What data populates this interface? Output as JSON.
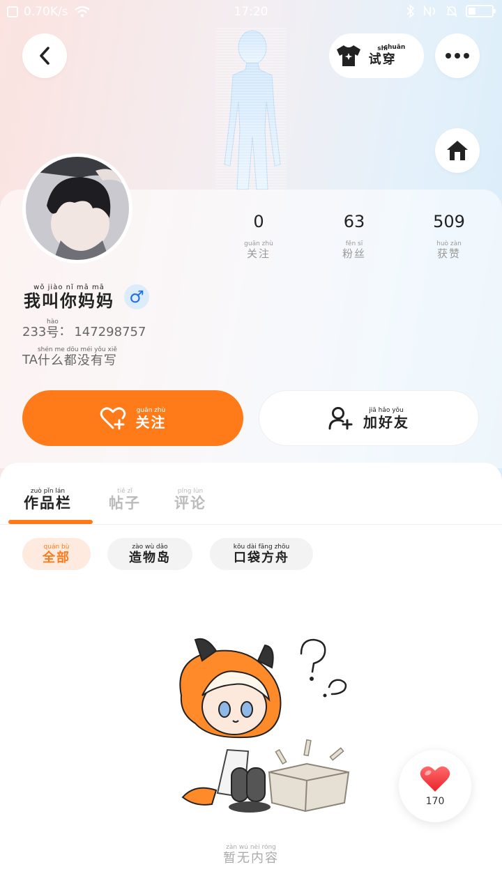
{
  "status_bar": {
    "speed": "0.70K/s",
    "time": "17:20"
  },
  "header": {
    "tryon": {
      "pinyin": [
        "shì",
        "chuān"
      ],
      "label": "试穿"
    }
  },
  "profile": {
    "stats": [
      {
        "value": "0",
        "pinyin": "guān zhù",
        "label": "关注"
      },
      {
        "value": "63",
        "pinyin": "fěn sī",
        "label": "粉丝"
      },
      {
        "value": "509",
        "pinyin": "huò zàn",
        "label": "获赞"
      }
    ],
    "nickname": {
      "pinyin": "wǒ jiào nǐ mā mā",
      "text": "我叫你妈妈"
    },
    "gender_symbol": "♂",
    "id": {
      "prefix": "233",
      "hao_pinyin": "hào",
      "hao": "号",
      "colon": "：",
      "value": "147298757"
    },
    "bio": {
      "prefix": "TA",
      "pinyin": "shén me dōu méi yǒu xiě",
      "text": "什么都没有写"
    }
  },
  "actions": {
    "follow": {
      "pinyin": "guān zhù",
      "label": "关注"
    },
    "add_friend": {
      "pinyin": "jiā hǎo yǒu",
      "label": "加好友"
    }
  },
  "tabs": [
    {
      "pinyin": "zuò pǐn lán",
      "label": "作品栏",
      "active": true
    },
    {
      "pinyin": "tiě zǐ",
      "label": "帖子",
      "active": false
    },
    {
      "pinyin": "píng lùn",
      "label": "评论",
      "active": false
    }
  ],
  "filters": [
    {
      "pinyin": "quán bù",
      "label": "全部",
      "active": true
    },
    {
      "pinyin": "zào wù dǎo",
      "label": "造物岛",
      "active": false
    },
    {
      "pinyin": "kǒu dài fāng zhōu",
      "label": "口袋方舟",
      "active": false
    }
  ],
  "empty_state": {
    "pinyin": "zàn wú nèi róng",
    "text": "暂无内容"
  },
  "like_fab": {
    "count": "170"
  },
  "colors": {
    "accent": "#ff7a18",
    "chip_active_bg": "#ffeadf",
    "male_blue": "#1e6fe0"
  }
}
